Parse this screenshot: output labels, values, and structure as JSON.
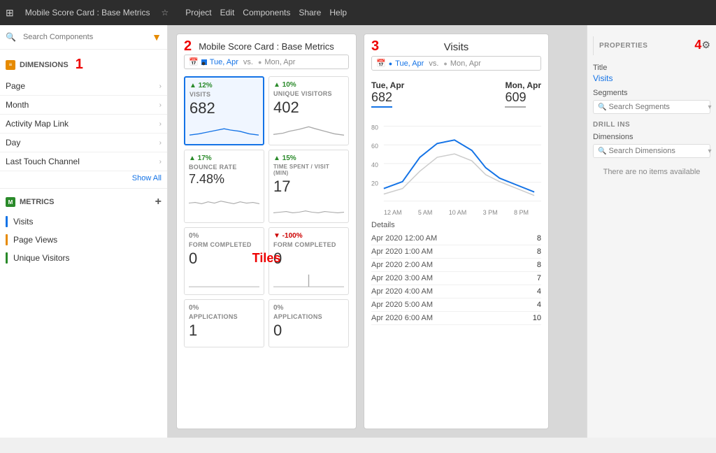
{
  "topBar": {
    "title": "Mobile Score Card : Base Metrics",
    "star": "☆",
    "menuItems": [
      "Project",
      "Edit",
      "Components",
      "Share",
      "Help"
    ]
  },
  "sidebar": {
    "searchPlaceholder": "Search Components",
    "dimensionsLabel": "DIMENSIONS",
    "items": [
      {
        "label": "Page"
      },
      {
        "label": "Month"
      },
      {
        "label": "Activity Map Link"
      },
      {
        "label": "Day"
      },
      {
        "label": "Last Touch Channel"
      }
    ],
    "showAll": "Show All",
    "metricsLabel": "METRICS",
    "metrics": [
      {
        "label": "Visits",
        "color": "#1473e6"
      },
      {
        "label": "Page Views",
        "color": "#e68a00"
      },
      {
        "label": "Unique Visitors",
        "color": "#2a8a2a"
      }
    ]
  },
  "mainPanel": {
    "annotation": "2",
    "title": "Mobile Score Card : Base Metrics",
    "dateFilter": {
      "icon": "📅",
      "text1": "Tue, Apr",
      "vs": "vs.",
      "text2": "Mon, Apr"
    },
    "tilesAnnotation": "Tiles",
    "tiles": [
      {
        "change": "▲ 12%",
        "changeType": "up",
        "label": "VISITS",
        "value": "682",
        "selected": true
      },
      {
        "change": "▲ 10%",
        "changeType": "up",
        "label": "UNIQUE VISITORS",
        "value": "402",
        "selected": false
      },
      {
        "change": "▲ 17%",
        "changeType": "up",
        "label": "BOUNCE RATE",
        "value": "7.48%",
        "selected": false
      },
      {
        "change": "▲ 15%",
        "changeType": "up",
        "label": "TIME SPENT / VISIT (MIN)",
        "value": "17",
        "selected": false
      },
      {
        "change": "0%",
        "changeType": "neutral",
        "label": "FORM COMPLETED",
        "value": "0",
        "selected": false
      },
      {
        "change": "▼ -100%",
        "changeType": "down",
        "label": "FORM COMPLETED",
        "value": "0",
        "selected": false
      },
      {
        "change": "0%",
        "changeType": "neutral",
        "label": "APPLICATIONS",
        "value": "1",
        "selected": false
      },
      {
        "change": "0%",
        "changeType": "neutral",
        "label": "APPLICATIONS",
        "value": "0",
        "selected": false
      }
    ]
  },
  "visitsPanel": {
    "annotation": "3",
    "title": "Visits",
    "dateFilter": {
      "text1": "Tue, Apr",
      "vs": "vs.",
      "text2": "Mon, Apr"
    },
    "tueDateLabel": "Tue, Apr",
    "monDateLabel": "Mon, Apr",
    "tueValue": "682",
    "monValue": "609",
    "chartYLabels": [
      "80",
      "60",
      "40",
      "20"
    ],
    "chartXLabels": [
      "12 AM",
      "5 AM",
      "10 AM",
      "3 PM",
      "8 PM"
    ],
    "detailsTitle": "Details",
    "details": [
      {
        "date": "Apr  2020 12:00 AM",
        "value": "8"
      },
      {
        "date": "Apr  2020 1:00 AM",
        "value": "8"
      },
      {
        "date": "Apr  2020 2:00 AM",
        "value": "8"
      },
      {
        "date": "Apr  2020 3:00 AM",
        "value": "7"
      },
      {
        "date": "Apr  2020 4:00 AM",
        "value": "4"
      },
      {
        "date": "Apr  2020 5:00 AM",
        "value": "4"
      },
      {
        "date": "Apr  2020 6:00 AM",
        "value": "10"
      }
    ]
  },
  "rightSidebar": {
    "annotation": "4",
    "propertiesLabel": "PROPERTIES",
    "titleLabel": "Title",
    "titleValue": "Visits",
    "segmentsLabel": "Segments",
    "segmentsPlaceholder": "Search Segments",
    "drillInsLabel": "DRILL INS",
    "dimensionsLabel": "Dimensions",
    "dimensionsPlaceholder": "Search Dimensions",
    "noItemsMsg": "There are no items available"
  },
  "annotations": {
    "num1": "1",
    "num2": "2",
    "num3": "3",
    "num4": "4",
    "tilesLabel": "Tiles"
  }
}
